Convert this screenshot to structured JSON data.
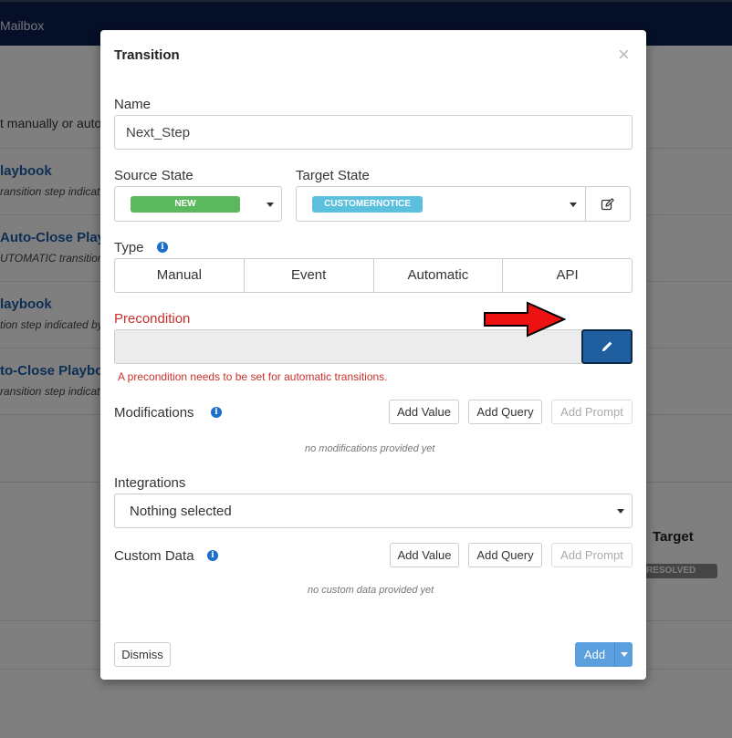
{
  "background": {
    "topbar_title": "Mailbox",
    "description": "t manually or auto",
    "items": [
      {
        "title": "laybook",
        "sub": "ransition step indicat"
      },
      {
        "title": "Auto-Close Playb",
        "sub": "UTOMATIC transition"
      },
      {
        "title": "laybook",
        "sub": "tion step indicated by"
      },
      {
        "title": "to-Close Playboo",
        "sub": "ransition step indicat"
      }
    ],
    "target_header": "Target",
    "resolved_badge": "RESOLVED"
  },
  "modal": {
    "title": "Transition",
    "close_symbol": "×",
    "name": {
      "label": "Name",
      "value": "Next_Step"
    },
    "source_state": {
      "label": "Source State",
      "selected": "NEW",
      "color": "#5cb85c"
    },
    "target_state": {
      "label": "Target State",
      "selected": "CUSTOMERNOTICE",
      "color": "#5bc0de"
    },
    "type": {
      "label": "Type",
      "options": [
        "Manual",
        "Event",
        "Automatic",
        "API"
      ]
    },
    "precondition": {
      "label": "Precondition",
      "error": "A precondition needs to be set for automatic transitions."
    },
    "modifications": {
      "label": "Modifications",
      "add_value": "Add Value",
      "add_query": "Add Query",
      "add_prompt": "Add Prompt",
      "empty": "no modifications provided yet"
    },
    "integrations": {
      "label": "Integrations",
      "selected": "Nothing selected"
    },
    "custom_data": {
      "label": "Custom Data",
      "add_value": "Add Value",
      "add_query": "Add Query",
      "add_prompt": "Add Prompt",
      "empty": "no custom data provided yet"
    },
    "footer": {
      "dismiss": "Dismiss",
      "add": "Add"
    }
  },
  "colors": {
    "primary": "#1f5fa0",
    "error": "#c9302c",
    "add_button": "#5b9fdf",
    "topbar": "#0a1e4f"
  }
}
